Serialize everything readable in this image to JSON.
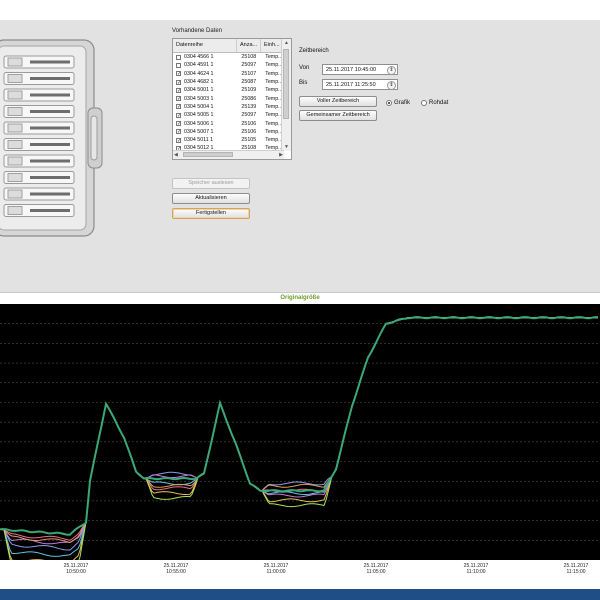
{
  "data_list": {
    "title": "Vorhandene Daten",
    "headers": [
      "Datenreihe",
      "Anza...",
      "Einh..."
    ],
    "rows": [
      {
        "name": "0304 4566 1",
        "count": "25108",
        "unit": "Temp...",
        "checked": false
      },
      {
        "name": "0304 4591 1",
        "count": "25097",
        "unit": "Temp...",
        "checked": false
      },
      {
        "name": "0304 4624 1",
        "count": "25107",
        "unit": "Temp...",
        "checked": true
      },
      {
        "name": "0304 4682 1",
        "count": "25087",
        "unit": "Temp...",
        "checked": true
      },
      {
        "name": "0304 5001 1",
        "count": "25109",
        "unit": "Temp...",
        "checked": true
      },
      {
        "name": "0304 5003 1",
        "count": "25086",
        "unit": "Temp...",
        "checked": true
      },
      {
        "name": "0304 5004 1",
        "count": "25139",
        "unit": "Temp...",
        "checked": true
      },
      {
        "name": "0304 5005 1",
        "count": "25097",
        "unit": "Temp...",
        "checked": true
      },
      {
        "name": "0304 5006 1",
        "count": "25106",
        "unit": "Temp...",
        "checked": true
      },
      {
        "name": "0304 5007 1",
        "count": "25106",
        "unit": "Temp...",
        "checked": true
      },
      {
        "name": "0304 5011 1",
        "count": "25105",
        "unit": "Temp...",
        "checked": true
      },
      {
        "name": "0304 5012 1",
        "count": "25108",
        "unit": "Temp...",
        "checked": true
      }
    ]
  },
  "zeitbereich": {
    "title": "Zeitbereich",
    "von_label": "Von",
    "von_value": "25.11.2017 10:45:00",
    "bis_label": "Bis",
    "bis_value": "25.11.2017 11:25:50",
    "full_button": "Voller Zeitbereich",
    "common_button": "Gemeinsamer Zeitbereich",
    "radio_grafik": "Grafik",
    "radio_rohdaten": "Rohdat",
    "selected_view": "Grafik"
  },
  "actions": {
    "read_memory": "Speicher auslesen",
    "refresh": "Aktualisieren",
    "finish": "Fertigstellen"
  },
  "chart_title": "Originalgröße",
  "colors": {
    "chart_bg": "#000000",
    "title_green": "#6e9c2a",
    "footer": "#1f4d86"
  },
  "chart_data": {
    "type": "line",
    "x_ticks": [
      {
        "date": "25.11.2017",
        "time": "10:50:00"
      },
      {
        "date": "25.11.2017",
        "time": "10:55:00"
      },
      {
        "date": "25.11.2017",
        "time": "11:00:00"
      },
      {
        "date": "25.11.2017",
        "time": "11:05:00"
      },
      {
        "date": "25.11.2017",
        "time": "11:10:00"
      },
      {
        "date": "25.11.2017",
        "time": "11:15:00"
      }
    ],
    "grid": true,
    "legend": "none",
    "y_range_relative": [
      0,
      100
    ],
    "main_series": {
      "color": "#3aa877",
      "points": [
        [
          0,
          11
        ],
        [
          3.5,
          9
        ],
        [
          4.3,
          14
        ],
        [
          4.5,
          31
        ],
        [
          5.3,
          63
        ],
        [
          6.2,
          49
        ],
        [
          6.8,
          35
        ],
        [
          7.2,
          32
        ],
        [
          9.8,
          32
        ],
        [
          10.2,
          34
        ],
        [
          11.0,
          63
        ],
        [
          11.8,
          46
        ],
        [
          12.5,
          30
        ],
        [
          13.0,
          27
        ],
        [
          16.2,
          27
        ],
        [
          16.8,
          36
        ],
        [
          17.6,
          62
        ],
        [
          18.4,
          82
        ],
        [
          19.3,
          96
        ],
        [
          20.4,
          98.5
        ],
        [
          30,
          98.5
        ]
      ]
    },
    "plateau_series": [
      {
        "color": "#e8708a",
        "offsets": [
          -2,
          -4,
          0
        ]
      },
      {
        "color": "#8a9ce8",
        "offsets": [
          -6,
          2,
          3
        ]
      },
      {
        "color": "#e2c24a",
        "offsets": [
          -12,
          -6,
          -4
        ]
      },
      {
        "color": "#60c6e0",
        "offsets": [
          -9,
          -2,
          -1
        ]
      },
      {
        "color": "#c27ae0",
        "offsets": [
          -4,
          1,
          -2
        ]
      },
      {
        "color": "#a8e060",
        "offsets": [
          -14,
          -8,
          -6
        ]
      },
      {
        "color": "#e09a60",
        "offsets": [
          -3,
          -3,
          2
        ]
      }
    ]
  }
}
